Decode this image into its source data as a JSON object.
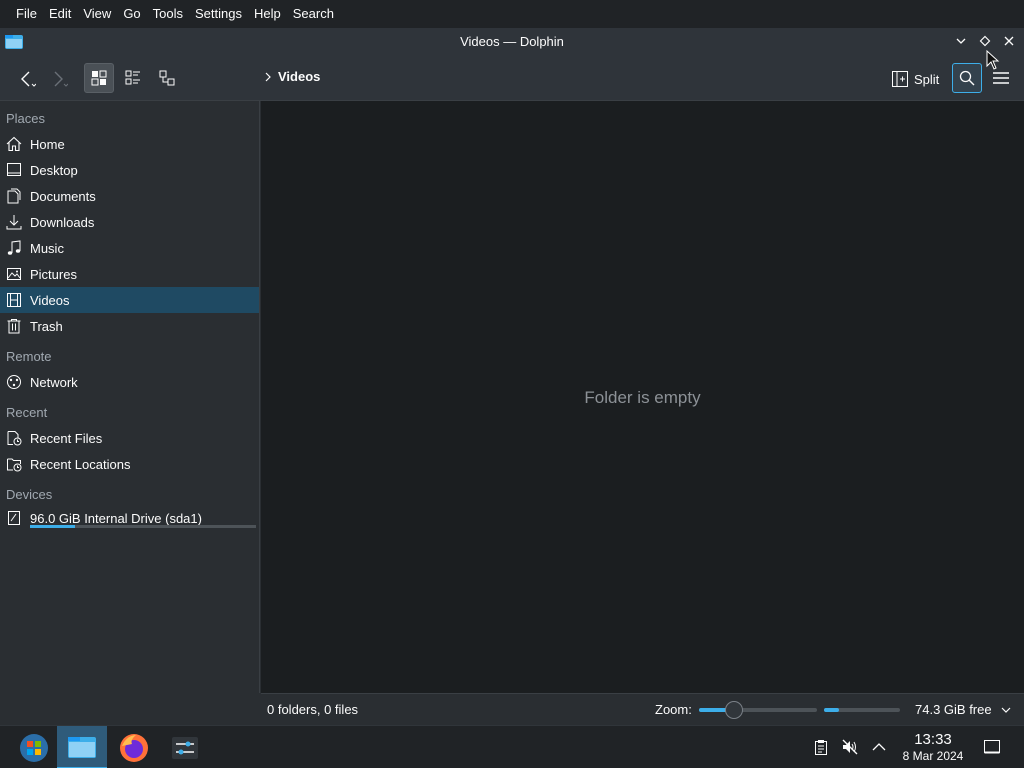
{
  "menubar": {
    "items": [
      "File",
      "Edit",
      "View",
      "Go",
      "Tools",
      "Settings",
      "Help",
      "Search"
    ]
  },
  "window": {
    "title": "Videos — Dolphin"
  },
  "toolbar": {
    "breadcrumb": "Videos",
    "split_label": "Split"
  },
  "sidebar": {
    "sections": {
      "places": "Places",
      "remote": "Remote",
      "recent": "Recent",
      "devices": "Devices"
    },
    "places": [
      {
        "label": "Home",
        "icon": "home-icon"
      },
      {
        "label": "Desktop",
        "icon": "desktop-icon"
      },
      {
        "label": "Documents",
        "icon": "documents-icon"
      },
      {
        "label": "Downloads",
        "icon": "downloads-icon"
      },
      {
        "label": "Music",
        "icon": "music-icon"
      },
      {
        "label": "Pictures",
        "icon": "pictures-icon"
      },
      {
        "label": "Videos",
        "icon": "videos-icon",
        "selected": true
      },
      {
        "label": "Trash",
        "icon": "trash-icon"
      }
    ],
    "remote": [
      {
        "label": "Network",
        "icon": "network-icon"
      }
    ],
    "recent": [
      {
        "label": "Recent Files",
        "icon": "recent-files-icon"
      },
      {
        "label": "Recent Locations",
        "icon": "recent-locations-icon"
      }
    ],
    "devices": [
      {
        "label": "96.0 GiB Internal Drive (sda1)",
        "icon": "drive-icon",
        "usage_fraction": 0.2
      }
    ]
  },
  "main": {
    "empty_message": "Folder is empty"
  },
  "statusbar": {
    "summary": "0 folders, 0 files",
    "zoom_label": "Zoom:",
    "zoom_fraction": 0.3,
    "free_space": "74.3 GiB free",
    "used_fraction": 0.2
  },
  "taskbar": {
    "apps": [
      "application-launcher-icon",
      "dolphin-icon",
      "firefox-icon",
      "system-settings-icon"
    ],
    "tray": [
      "clipboard-icon",
      "volume-muted-icon",
      "tray-expand-icon"
    ],
    "time": "13:33",
    "date": "8 Mar 2024"
  },
  "colors": {
    "accent": "#3daee9",
    "selection": "#1f4a63",
    "window_bg": "#2a2e32",
    "view_bg": "#1b1e20"
  }
}
